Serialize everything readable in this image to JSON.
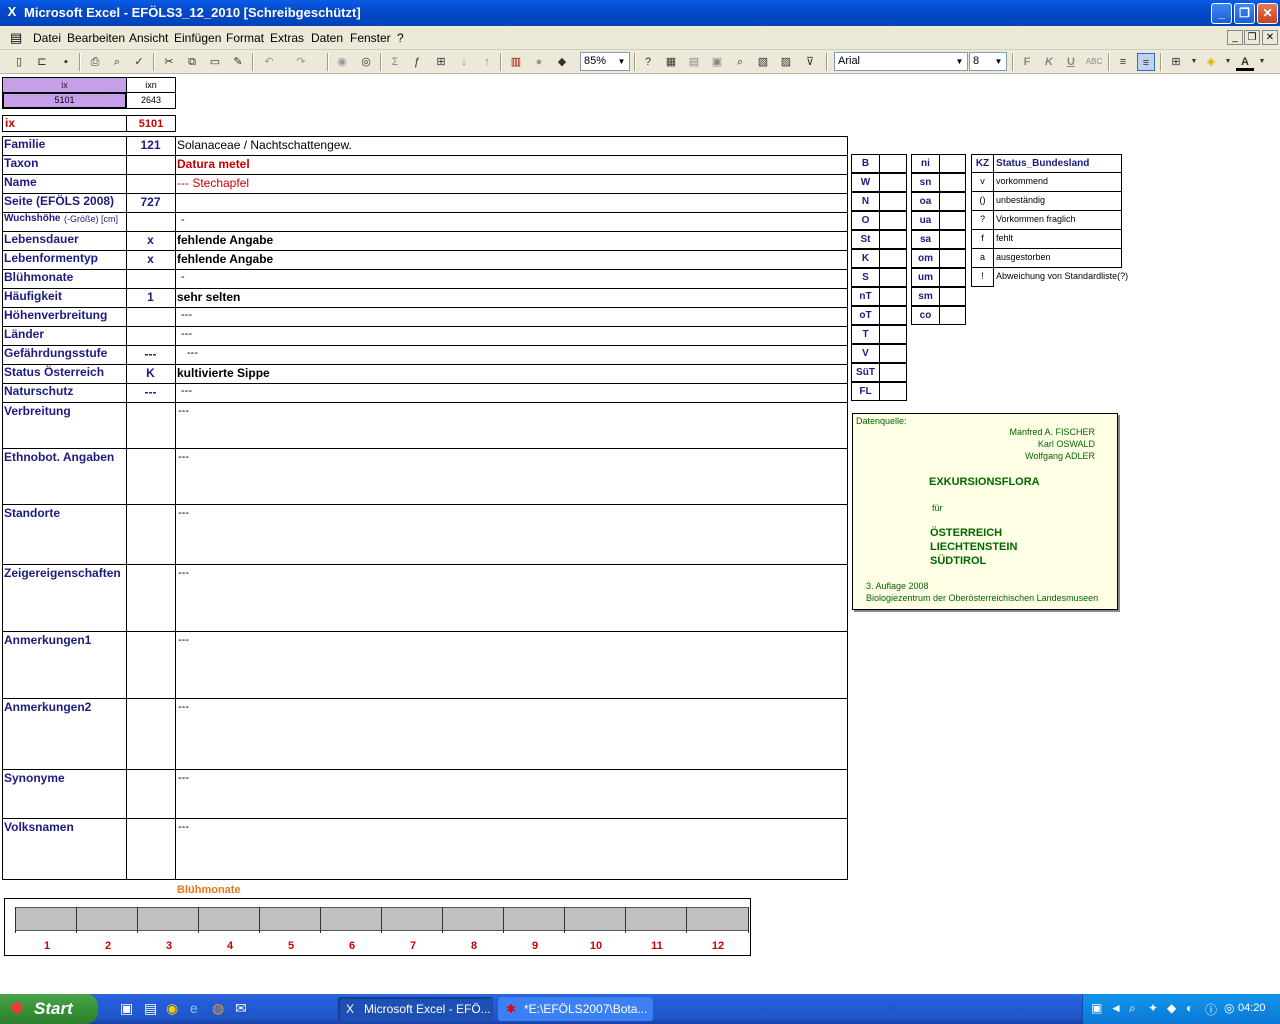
{
  "window": {
    "app_icon": "excel-icon",
    "title": "Microsoft Excel - EFÖLS3_12_2010  [Schreibgeschützt]"
  },
  "menu": {
    "items": [
      "Datei",
      "Bearbeiten",
      "Ansicht",
      "Einfügen",
      "Format",
      "Extras",
      "Daten",
      "Fenster",
      "?"
    ]
  },
  "toolbar": {
    "zoom": "85%",
    "font": "Arial",
    "size": "8",
    "bold_label": "F",
    "italic_label": "K",
    "underline_label": "U"
  },
  "lookup": {
    "ix_header": "ix",
    "ixn_header": "ixn",
    "ix_value": "5101",
    "ixn_value": "2643",
    "ix_label": "ix",
    "ix_value2": "5101"
  },
  "rows": [
    {
      "label": "Familie",
      "code": "121",
      "text": "Solanaceae  /  Nachtschattengew."
    },
    {
      "label": "Taxon",
      "code": "",
      "text": "Datura metel"
    },
    {
      "label": "Name",
      "code": "",
      "text": "--- Stechapfel"
    },
    {
      "label": "Seite (EFÖLS 2008)",
      "code": "727",
      "text": ""
    },
    {
      "label": "Wuchshöhe",
      "label_suffix": "(-Größe) [cm]",
      "code": "",
      "text": "-"
    },
    {
      "label": "Lebensdauer",
      "code": "x",
      "text": "fehlende Angabe"
    },
    {
      "label": "Lebenformentyp",
      "code": "x",
      "text": "fehlende Angabe"
    },
    {
      "label": "Blühmonate",
      "code": "",
      "text": "-"
    },
    {
      "label": "Häufigkeit",
      "code": "1",
      "text": "sehr selten"
    },
    {
      "label": "Höhenverbreitung",
      "code": "",
      "text": "---"
    },
    {
      "label": "Länder",
      "code": "",
      "text": "---"
    },
    {
      "label": "Gefährdungsstufe",
      "code": "---",
      "text": "---"
    },
    {
      "label": "Status Österreich",
      "code": "K",
      "text": "kultivierte Sippe"
    },
    {
      "label": "Naturschutz",
      "code": "---",
      "text": "---"
    }
  ],
  "tall_rows": [
    {
      "label": "Verbreitung",
      "text": "---"
    },
    {
      "label": "Ethnobot. Angaben",
      "text": "---"
    },
    {
      "label": "Standorte",
      "text": "---"
    },
    {
      "label": "Zeigereigenschaften",
      "text": "---"
    },
    {
      "label": "Anmerkungen1",
      "text": "---"
    },
    {
      "label": "Anmerkungen2",
      "text": "---"
    },
    {
      "label": "Synonyme",
      "text": "---"
    },
    {
      "label": "Volksnamen",
      "text": "---"
    }
  ],
  "status_col1": [
    "B",
    "W",
    "N",
    "O",
    "St",
    "K",
    "S",
    "nT",
    "oT",
    "T",
    "V",
    "SüT",
    "FL"
  ],
  "status_col2": [
    "ni",
    "sn",
    "oa",
    "ua",
    "sa",
    "om",
    "um",
    "sm",
    "co"
  ],
  "legend": {
    "kz_header": "KZ",
    "title": "Status_Bundesland",
    "entries": [
      {
        "code": "v",
        "text": "vorkommend"
      },
      {
        "code": "()",
        "text": "unbeständig"
      },
      {
        "code": "?",
        "text": "Vorkommen fraglich"
      },
      {
        "code": "f",
        "text": "fehlt"
      },
      {
        "code": "a",
        "text": "ausgestorben"
      },
      {
        "code": "!",
        "text": "Abweichung von Standardliste(?)"
      }
    ]
  },
  "source_box": {
    "label": "Datenquelle:",
    "authors": [
      "Manfred A. FISCHER",
      "Karl OSWALD",
      "Wolfgang ADLER"
    ],
    "title": "EXKURSIONSFLORA",
    "for": "für",
    "countries": [
      "ÖSTERREICH",
      "LIECHTENSTEIN",
      "SÜDTIROL"
    ],
    "edition": "3. Auflage 2008",
    "publisher": "Biologiezentrum der Oberösterreichischen Landesmuseen"
  },
  "bloom": {
    "title": "Blühmonate",
    "months": [
      "1",
      "2",
      "3",
      "4",
      "5",
      "6",
      "7",
      "8",
      "9",
      "10",
      "11",
      "12"
    ]
  },
  "taskbar": {
    "start": "Start",
    "tasks": [
      "Microsoft Excel - EFÖ...",
      "*E:\\EFÖLS2007\\Bota..."
    ],
    "clock": "04:20"
  },
  "colors": {
    "titlebar": "#0449c9",
    "label_blue": "#1c1c80",
    "taxon_red": "#cc0000",
    "lookup_purple": "#c5a0e8",
    "source_green": "#006600",
    "source_bg": "#ffffe6",
    "bloom_orange": "#e87722",
    "month_red": "#cc0000"
  }
}
